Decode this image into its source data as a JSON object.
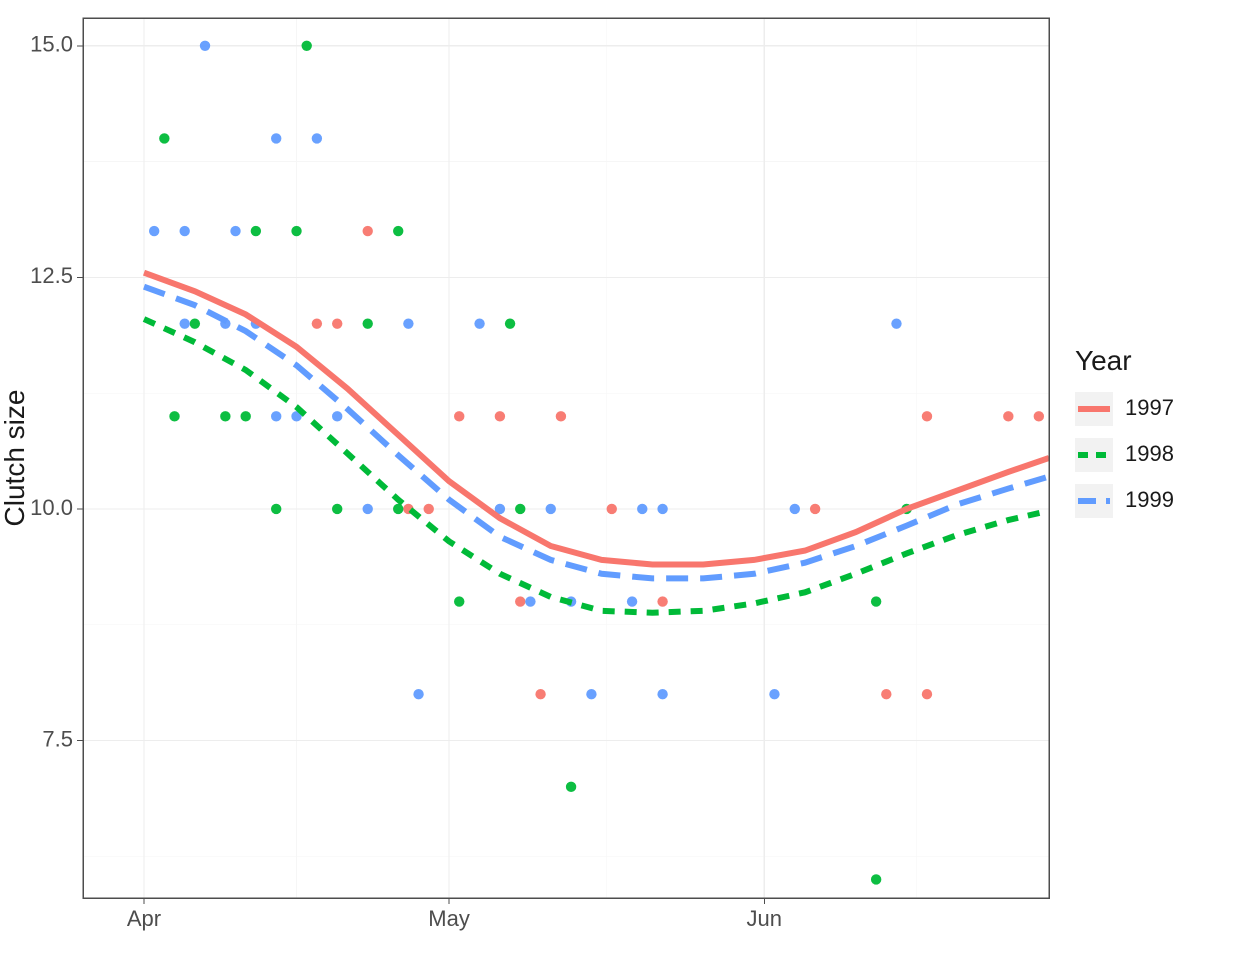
{
  "chart_data": {
    "type": "scatter",
    "title": "",
    "xlabel": "",
    "ylabel": "Clutch size",
    "ylim": [
      5.8,
      15.3
    ],
    "xlim": [
      85,
      180
    ],
    "x_ticks": [
      {
        "day": 91,
        "label": "Apr"
      },
      {
        "day": 121,
        "label": "May"
      },
      {
        "day": 152,
        "label": "Jun"
      }
    ],
    "y_ticks": [
      7.5,
      10.0,
      12.5,
      15.0
    ],
    "legend_title": "Year",
    "colors": {
      "1997": "#F8766D",
      "1998": "#00BA38",
      "1999": "#619CFF"
    },
    "series_points": [
      {
        "name": "1997",
        "color": "#F8766D",
        "points": [
          {
            "day": 108,
            "y": 12
          },
          {
            "day": 110,
            "y": 12
          },
          {
            "day": 113,
            "y": 13
          },
          {
            "day": 117,
            "y": 10
          },
          {
            "day": 119,
            "y": 10
          },
          {
            "day": 122,
            "y": 11
          },
          {
            "day": 126,
            "y": 11
          },
          {
            "day": 128,
            "y": 9
          },
          {
            "day": 130,
            "y": 8
          },
          {
            "day": 132,
            "y": 11
          },
          {
            "day": 137,
            "y": 10
          },
          {
            "day": 142,
            "y": 9
          },
          {
            "day": 157,
            "y": 10
          },
          {
            "day": 164,
            "y": 8
          },
          {
            "day": 168,
            "y": 8
          },
          {
            "day": 168,
            "y": 11
          },
          {
            "day": 176,
            "y": 11
          },
          {
            "day": 179,
            "y": 11
          }
        ]
      },
      {
        "name": "1998",
        "color": "#00BA38",
        "points": [
          {
            "day": 93,
            "y": 14
          },
          {
            "day": 94,
            "y": 11
          },
          {
            "day": 96,
            "y": 12
          },
          {
            "day": 99,
            "y": 11
          },
          {
            "day": 101,
            "y": 11
          },
          {
            "day": 102,
            "y": 13
          },
          {
            "day": 104,
            "y": 10
          },
          {
            "day": 106,
            "y": 13
          },
          {
            "day": 107,
            "y": 15
          },
          {
            "day": 110,
            "y": 10
          },
          {
            "day": 113,
            "y": 12
          },
          {
            "day": 116,
            "y": 13
          },
          {
            "day": 116,
            "y": 10
          },
          {
            "day": 122,
            "y": 9
          },
          {
            "day": 127,
            "y": 12
          },
          {
            "day": 128,
            "y": 10
          },
          {
            "day": 133,
            "y": 7
          },
          {
            "day": 163,
            "y": 6
          },
          {
            "day": 163,
            "y": 9
          },
          {
            "day": 166,
            "y": 10
          }
        ]
      },
      {
        "name": "1999",
        "color": "#619CFF",
        "points": [
          {
            "day": 92,
            "y": 13
          },
          {
            "day": 95,
            "y": 13
          },
          {
            "day": 95,
            "y": 12
          },
          {
            "day": 97,
            "y": 15
          },
          {
            "day": 99,
            "y": 12
          },
          {
            "day": 100,
            "y": 13
          },
          {
            "day": 102,
            "y": 12
          },
          {
            "day": 104,
            "y": 11
          },
          {
            "day": 104,
            "y": 14
          },
          {
            "day": 106,
            "y": 11
          },
          {
            "day": 108,
            "y": 14
          },
          {
            "day": 110,
            "y": 11
          },
          {
            "day": 113,
            "y": 10
          },
          {
            "day": 117,
            "y": 12
          },
          {
            "day": 118,
            "y": 8
          },
          {
            "day": 124,
            "y": 12
          },
          {
            "day": 126,
            "y": 10
          },
          {
            "day": 129,
            "y": 9
          },
          {
            "day": 131,
            "y": 10
          },
          {
            "day": 133,
            "y": 9
          },
          {
            "day": 135,
            "y": 8
          },
          {
            "day": 139,
            "y": 9
          },
          {
            "day": 140,
            "y": 10
          },
          {
            "day": 142,
            "y": 10
          },
          {
            "day": 142,
            "y": 8
          },
          {
            "day": 153,
            "y": 8
          },
          {
            "day": 155,
            "y": 10
          },
          {
            "day": 165,
            "y": 12
          }
        ]
      }
    ],
    "series_lines": [
      {
        "name": "1997",
        "color": "#F8766D",
        "dash": "",
        "points": [
          {
            "day": 91,
            "y": 12.55
          },
          {
            "day": 96,
            "y": 12.35
          },
          {
            "day": 101,
            "y": 12.1
          },
          {
            "day": 106,
            "y": 11.75
          },
          {
            "day": 111,
            "y": 11.3
          },
          {
            "day": 116,
            "y": 10.8
          },
          {
            "day": 121,
            "y": 10.3
          },
          {
            "day": 126,
            "y": 9.9
          },
          {
            "day": 131,
            "y": 9.6
          },
          {
            "day": 136,
            "y": 9.45
          },
          {
            "day": 141,
            "y": 9.4
          },
          {
            "day": 146,
            "y": 9.4
          },
          {
            "day": 151,
            "y": 9.45
          },
          {
            "day": 156,
            "y": 9.55
          },
          {
            "day": 161,
            "y": 9.75
          },
          {
            "day": 166,
            "y": 10.0
          },
          {
            "day": 171,
            "y": 10.2
          },
          {
            "day": 176,
            "y": 10.4
          },
          {
            "day": 180,
            "y": 10.55
          }
        ]
      },
      {
        "name": "1998",
        "color": "#00BA38",
        "dash": "12 10",
        "points": [
          {
            "day": 91,
            "y": 12.05
          },
          {
            "day": 96,
            "y": 11.8
          },
          {
            "day": 101,
            "y": 11.5
          },
          {
            "day": 106,
            "y": 11.1
          },
          {
            "day": 111,
            "y": 10.6
          },
          {
            "day": 116,
            "y": 10.1
          },
          {
            "day": 121,
            "y": 9.65
          },
          {
            "day": 126,
            "y": 9.3
          },
          {
            "day": 131,
            "y": 9.05
          },
          {
            "day": 136,
            "y": 8.9
          },
          {
            "day": 141,
            "y": 8.88
          },
          {
            "day": 146,
            "y": 8.9
          },
          {
            "day": 151,
            "y": 8.98
          },
          {
            "day": 156,
            "y": 9.1
          },
          {
            "day": 161,
            "y": 9.3
          },
          {
            "day": 166,
            "y": 9.52
          },
          {
            "day": 171,
            "y": 9.72
          },
          {
            "day": 176,
            "y": 9.88
          },
          {
            "day": 180,
            "y": 9.98
          }
        ]
      },
      {
        "name": "1999",
        "color": "#619CFF",
        "dash": "22 12",
        "points": [
          {
            "day": 91,
            "y": 12.4
          },
          {
            "day": 96,
            "y": 12.2
          },
          {
            "day": 101,
            "y": 11.92
          },
          {
            "day": 106,
            "y": 11.55
          },
          {
            "day": 111,
            "y": 11.08
          },
          {
            "day": 116,
            "y": 10.58
          },
          {
            "day": 121,
            "y": 10.1
          },
          {
            "day": 126,
            "y": 9.7
          },
          {
            "day": 131,
            "y": 9.45
          },
          {
            "day": 136,
            "y": 9.3
          },
          {
            "day": 141,
            "y": 9.25
          },
          {
            "day": 146,
            "y": 9.25
          },
          {
            "day": 151,
            "y": 9.3
          },
          {
            "day": 156,
            "y": 9.42
          },
          {
            "day": 161,
            "y": 9.6
          },
          {
            "day": 166,
            "y": 9.82
          },
          {
            "day": 171,
            "y": 10.05
          },
          {
            "day": 176,
            "y": 10.22
          },
          {
            "day": 180,
            "y": 10.35
          }
        ]
      }
    ]
  },
  "legend": {
    "title": "Year",
    "items": [
      "1997",
      "1998",
      "1999"
    ]
  },
  "axes": {
    "ylabel": "Clutch size",
    "y_ticks": [
      "7.5",
      "10.0",
      "12.5",
      "15.0"
    ],
    "x_ticks": [
      "Apr",
      "May",
      "Jun"
    ]
  }
}
